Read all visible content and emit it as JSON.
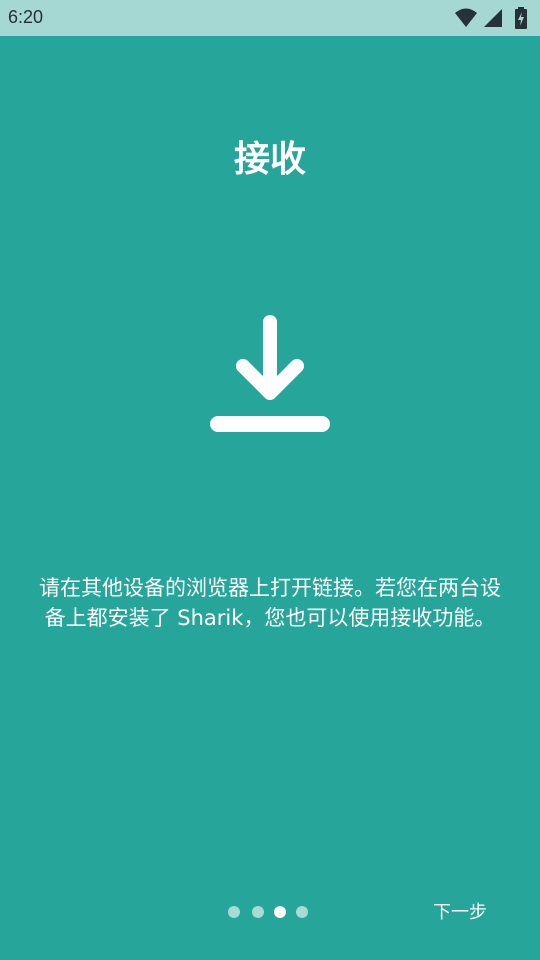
{
  "status_bar": {
    "time": "6:20",
    "icons": [
      "wifi-icon",
      "cell-signal-icon",
      "battery-charging-icon"
    ]
  },
  "page": {
    "title": "接收",
    "icon": "download-icon",
    "description": "请在其他设备的浏览器上打开链接。若您在两台设备上都安装了 Sharik，您也可以使用接收功能。"
  },
  "pager": {
    "total": 4,
    "active_index": 2
  },
  "actions": {
    "next_label": "下一步"
  },
  "colors": {
    "background": "#26a69a",
    "status_bar": "#a5d7d3",
    "foreground": "#ffffff"
  }
}
